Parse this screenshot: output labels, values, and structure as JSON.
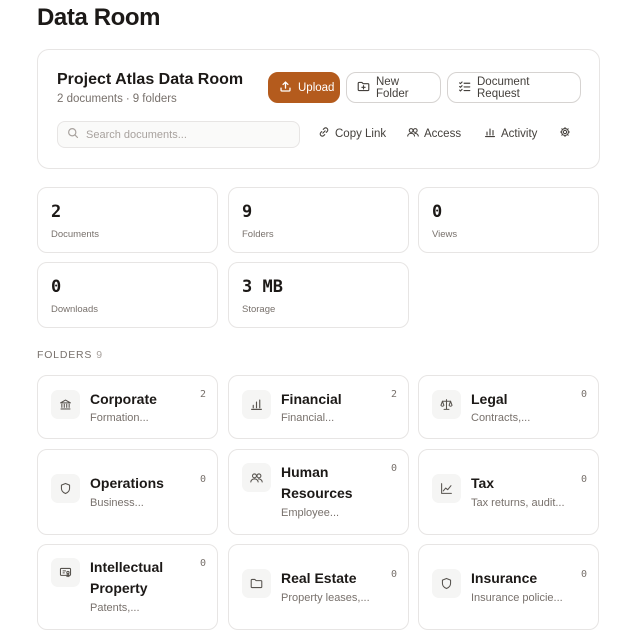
{
  "page": {
    "title": "Data Room"
  },
  "room": {
    "title": "Project Atlas Data Room",
    "documents_meta": "2 documents",
    "folders_meta": "9 folders",
    "meta_separator": "·"
  },
  "toolbar": {
    "upload_label": "Upload",
    "new_folder_label": "New Folder",
    "document_request_label": "Document Request",
    "search_placeholder": "Search documents...",
    "copy_link_label": "Copy Link",
    "access_label": "Access",
    "activity_label": "Activity"
  },
  "stats": [
    {
      "value": "2",
      "label": "Documents"
    },
    {
      "value": "9",
      "label": "Folders"
    },
    {
      "value": "0",
      "label": "Views"
    },
    {
      "value": "0",
      "label": "Downloads"
    },
    {
      "value": "3 MB",
      "label": "Storage"
    }
  ],
  "folders_section": {
    "label": "FOLDERS",
    "count": "9"
  },
  "folders": [
    {
      "name": "Corporate",
      "desc": "Formation...",
      "count": "2",
      "icon": "bank-icon"
    },
    {
      "name": "Financial",
      "desc": "Financial...",
      "count": "2",
      "icon": "bar-chart-icon"
    },
    {
      "name": "Legal",
      "desc": "Contracts,...",
      "count": "0",
      "icon": "scale-icon"
    },
    {
      "name": "Operations",
      "desc": "Business...",
      "count": "0",
      "icon": "shield-icon"
    },
    {
      "name": "Human Resources",
      "desc": "Employee...",
      "count": "0",
      "icon": "users-icon"
    },
    {
      "name": "Tax",
      "desc": "Tax returns, audit...",
      "count": "0",
      "icon": "line-chart-icon"
    },
    {
      "name": "Intellectual Property",
      "desc": "Patents,...",
      "count": "0",
      "icon": "certificate-icon"
    },
    {
      "name": "Real Estate",
      "desc": "Property leases,...",
      "count": "0",
      "icon": "folder-icon"
    },
    {
      "name": "Insurance",
      "desc": "Insurance policie...",
      "count": "0",
      "icon": "shield-icon"
    }
  ],
  "colors": {
    "accent": "#b45b1d",
    "text": "#1c1917",
    "muted": "#78716c",
    "border": "#e7e5e4"
  }
}
